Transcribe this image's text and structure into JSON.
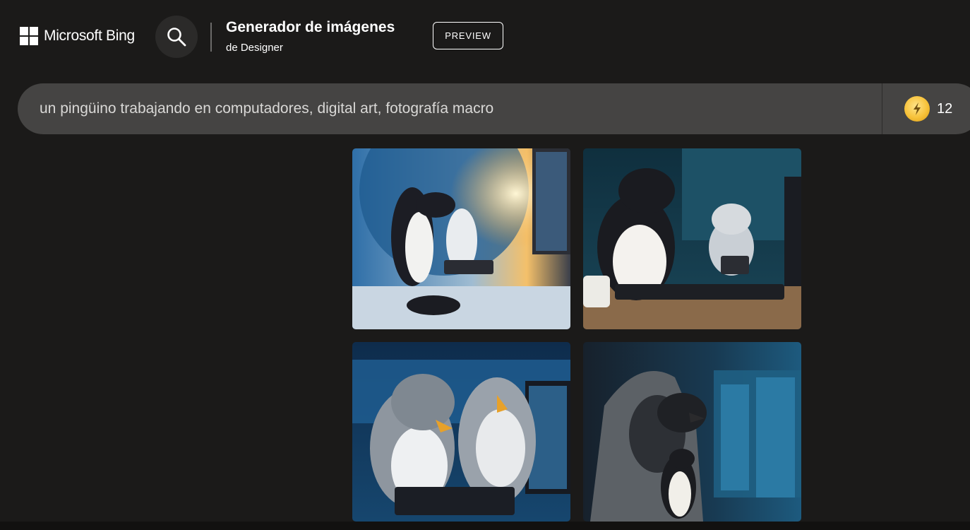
{
  "header": {
    "brand": "Microsoft Bing",
    "title": "Generador de imágenes",
    "subtitle": "de Designer",
    "preview_label": "PREVIEW",
    "search_icon": "search-icon"
  },
  "prompt": {
    "value": "un pingüino trabajando en computadores, digital art, fotografía macro"
  },
  "boosts": {
    "count": "12",
    "icon": "lightning-coin-icon"
  },
  "results": {
    "images": [
      {
        "description_name": "penguin-image-1"
      },
      {
        "description_name": "penguin-image-2"
      },
      {
        "description_name": "penguin-image-3"
      },
      {
        "description_name": "penguin-image-4"
      }
    ]
  },
  "colors": {
    "background": "#1b1a19",
    "prompt_bar": "#454443",
    "coin": "#f7c23a"
  }
}
